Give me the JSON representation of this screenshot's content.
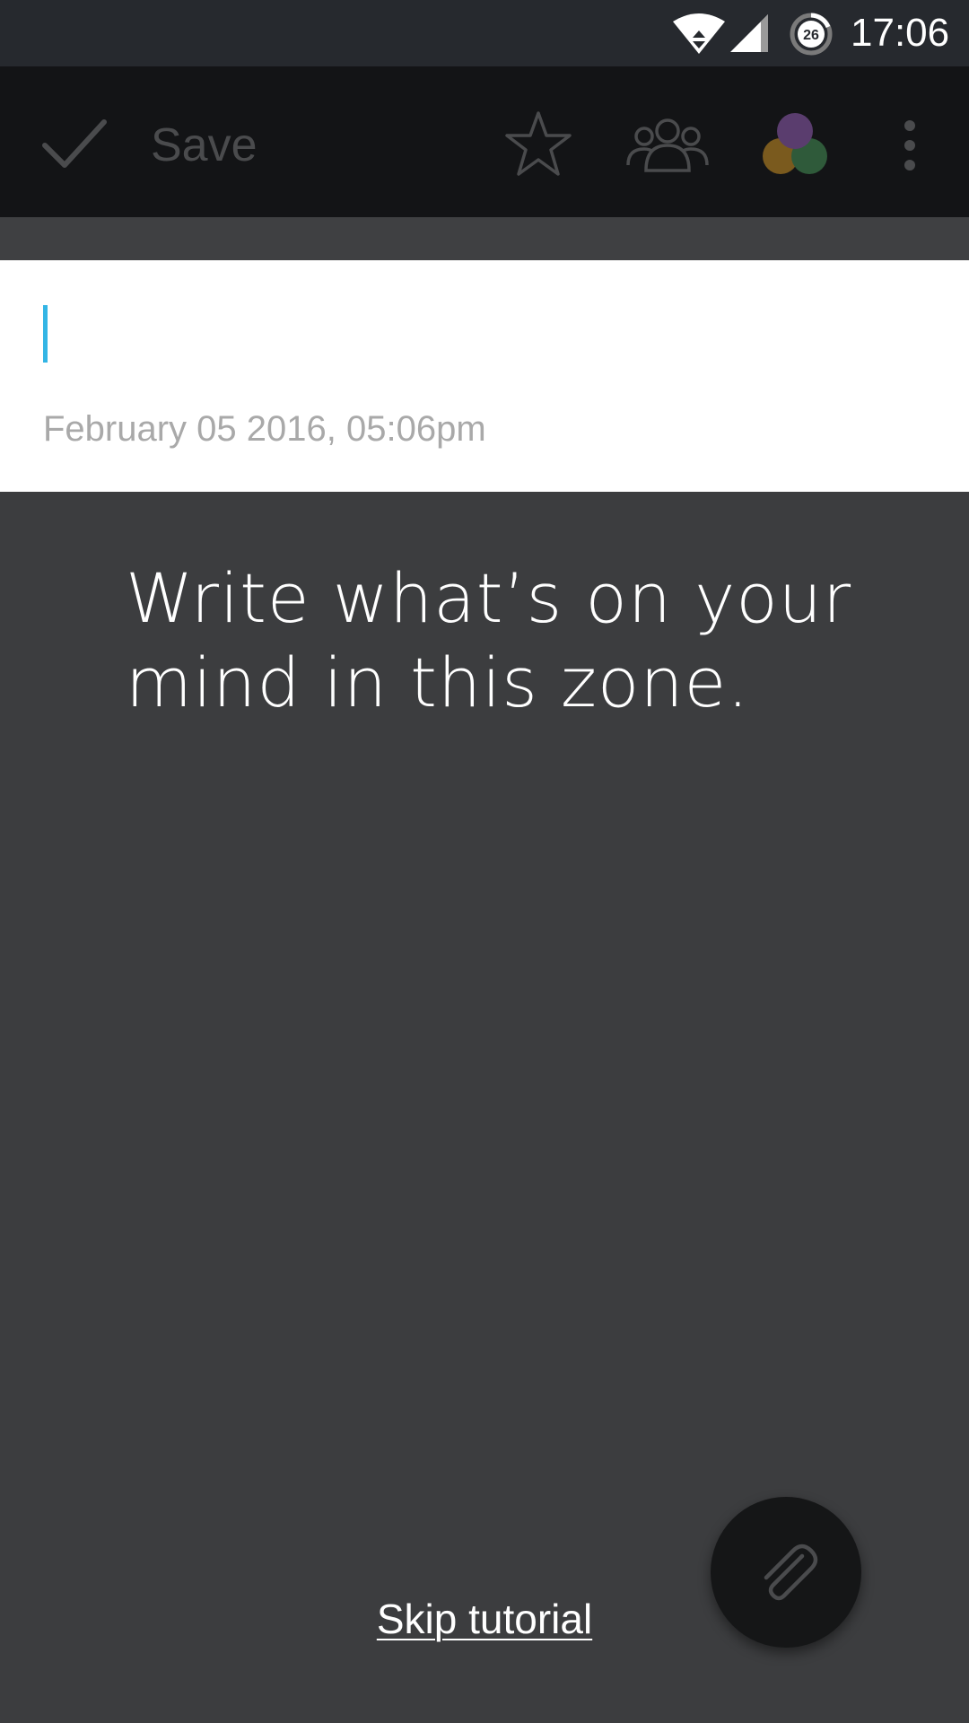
{
  "status_bar": {
    "time": "17:06",
    "battery_level": "26",
    "icons": [
      "wifi-icon",
      "cell-signal-icon",
      "battery-icon"
    ]
  },
  "toolbar": {
    "save_label": "Save",
    "icons": [
      "check-icon",
      "star-icon",
      "people-icon",
      "color-picker-icon",
      "more-vert-icon"
    ],
    "color_picker_colors": [
      "#5a3d6e",
      "#7a5a1e",
      "#2f5a3a"
    ]
  },
  "note": {
    "title_value": "",
    "date": "February 05 2016, 05:06pm"
  },
  "tutorial": {
    "message": "Write what’s on your mind in this zone.",
    "skip_label": "Skip tutorial"
  },
  "fab": {
    "icon": "attach-icon"
  },
  "colors": {
    "accent": "#33b5e5",
    "overlay": "#3c3d3f",
    "toolbar": "#131416"
  }
}
